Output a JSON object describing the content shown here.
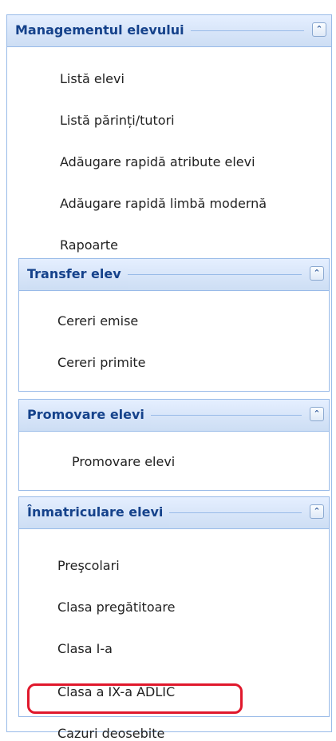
{
  "main_panel": {
    "title": "Managementul elevului",
    "toggle_icon": "chevron-double-up-icon",
    "items": [
      "Listă elevi",
      "Listă părinți/tutori",
      "Adăugare rapidă atribute elevi",
      "Adăugare rapidă limbă modernă",
      "Rapoarte"
    ]
  },
  "transfer_panel": {
    "title": "Transfer elev",
    "items": [
      "Cereri emise",
      "Cereri primite"
    ]
  },
  "promovare_panel": {
    "title": "Promovare elevi",
    "items": [
      "Promovare elevi"
    ]
  },
  "inmatriculare_panel": {
    "title": "Înmatriculare elevi",
    "items": [
      "Preşcolari",
      "Clasa pregătitoare",
      "Clasa I-a",
      "Clasa a IX-a ADLIC",
      "Cazuri deosebite"
    ],
    "highlighted_item": "Clasa a IX-a ADLIC"
  },
  "colors": {
    "header_text": "#15428b",
    "border": "#99bbe8",
    "highlight": "#e0182c"
  }
}
